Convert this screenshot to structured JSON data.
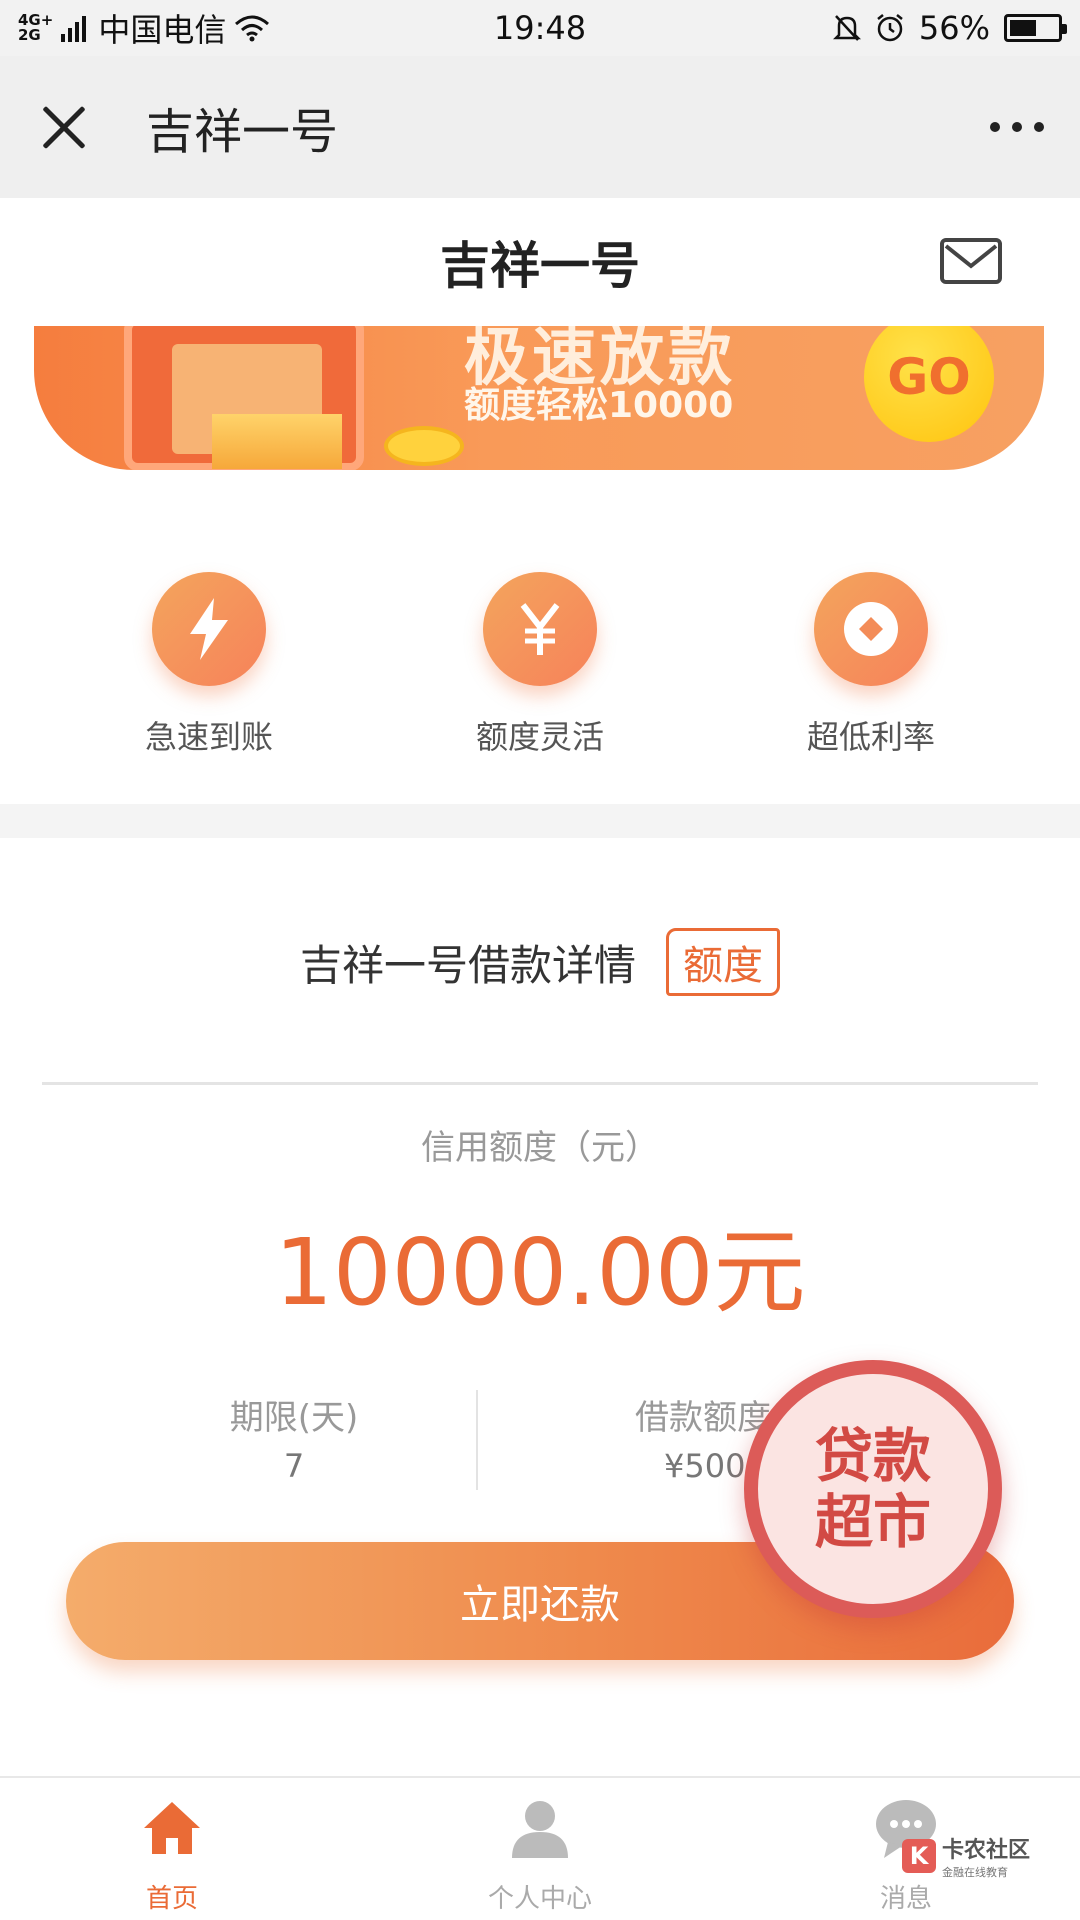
{
  "status_bar": {
    "network_top": "4G+",
    "network_bottom": "2G",
    "carrier": "中国电信",
    "time": "19:48",
    "battery_percent": "56%",
    "battery_level": 0.56
  },
  "nav": {
    "title": "吉祥一号"
  },
  "header": {
    "title": "吉祥一号"
  },
  "banner": {
    "headline": "极速放款",
    "subline": "额度轻松10000",
    "go_label": "GO"
  },
  "features": [
    {
      "label": "急速到账",
      "icon": "lightning-icon"
    },
    {
      "label": "额度灵活",
      "icon": "yen-icon"
    },
    {
      "label": "超低利率",
      "icon": "coin-icon"
    }
  ],
  "detail": {
    "title": "吉祥一号借款详情",
    "tag": "额度",
    "credit_label": "信用额度（元）",
    "credit_amount": "10000.00元",
    "term_label": "期限(天)",
    "term_value": "7",
    "loan_label": "借款额度（",
    "loan_value": "¥500.0",
    "repay_button": "立即还款"
  },
  "floating_badge": {
    "line1": "贷款",
    "line2": "超市"
  },
  "tabs": [
    {
      "label": "首页",
      "icon": "home-icon",
      "active": true
    },
    {
      "label": "个人中心",
      "icon": "user-icon",
      "active": false
    },
    {
      "label": "消息",
      "icon": "message-icon",
      "active": false
    }
  ],
  "watermark": {
    "title": "卡农社区",
    "subtitle": "金融在线教育"
  },
  "colors": {
    "accent": "#ea6b36",
    "badge": "#dc5b58"
  }
}
